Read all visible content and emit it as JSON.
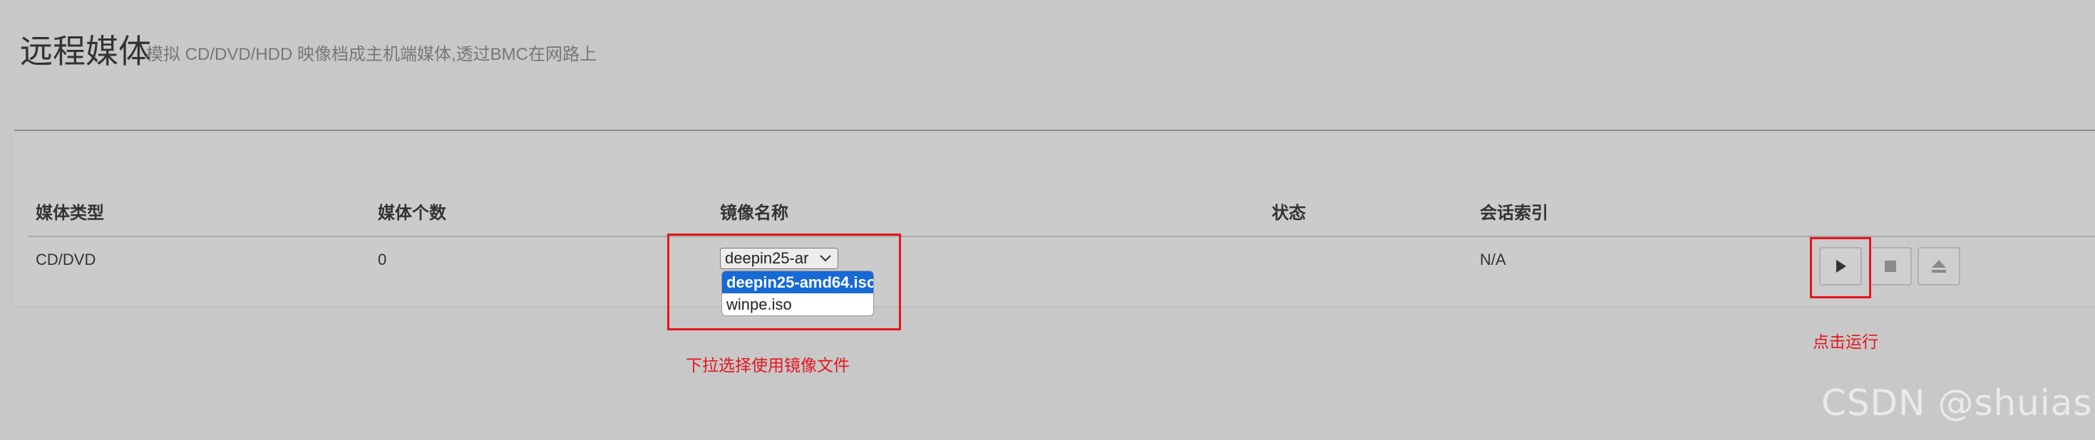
{
  "page": {
    "title": "远程媒体",
    "subtitle": "模拟 CD/DVD/HDD 映像档成主机端媒体,透过BMC在网路上"
  },
  "table": {
    "headers": [
      "媒体类型",
      "媒体个数",
      "镜像名称",
      "状态",
      "会话索引"
    ],
    "row": {
      "media_type": "CD/DVD",
      "media_count": "0",
      "image_select_value": "deepin25-ar",
      "status": "",
      "session_index": "N/A"
    }
  },
  "image_dropdown": {
    "options": [
      "deepin25-amd64.iso",
      "winpe.iso"
    ],
    "selected": "deepin25-amd64.iso"
  },
  "actions": {
    "icons": [
      "play-icon",
      "stop-icon",
      "eject-icon"
    ]
  },
  "annotations": {
    "select_hint": "下拉选择使用镜像文件",
    "run_hint": "点击运行"
  },
  "watermark": "CSDN @shuias",
  "colors": {
    "annotation": "#e8141e",
    "selected_option": "#1769d6"
  }
}
